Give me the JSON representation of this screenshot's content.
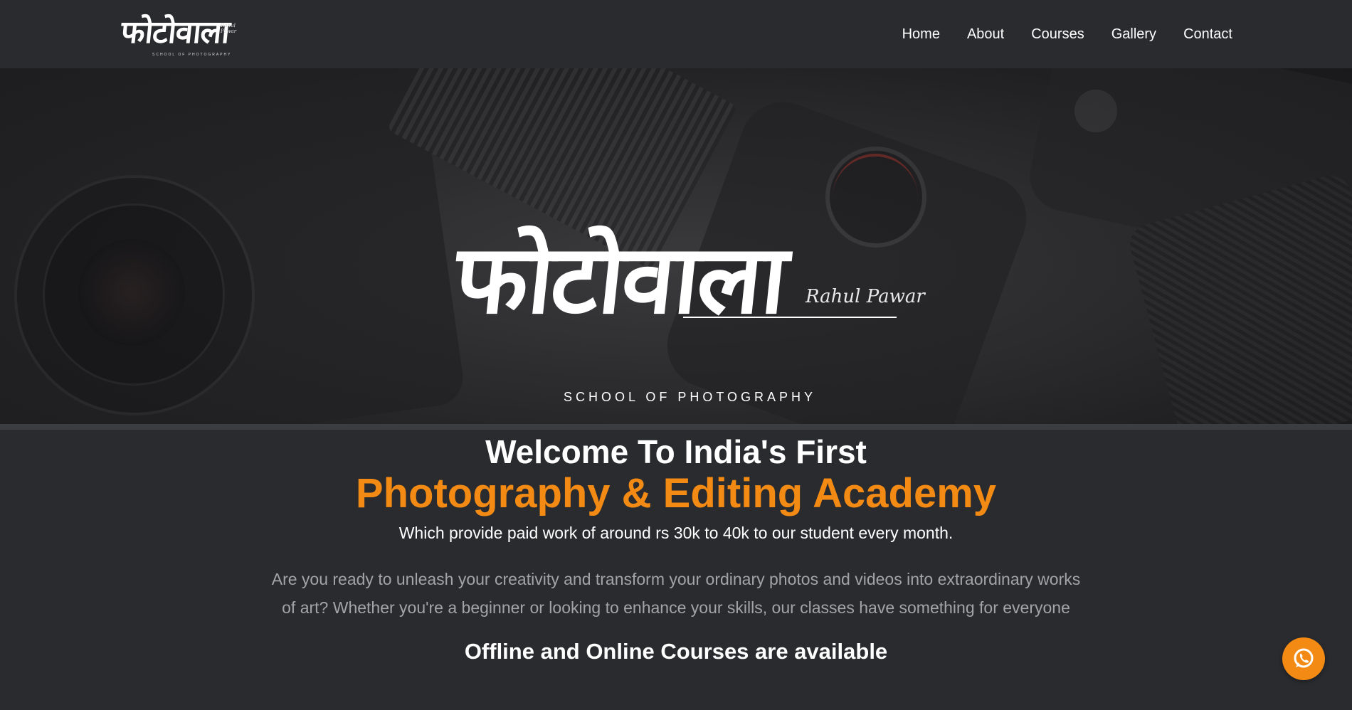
{
  "brand": {
    "logo_text": "फोटोवाला",
    "signature": "Rahul Pawar",
    "tagline": "SCHOOL OF PHOTOGRAPHY"
  },
  "nav": {
    "items": [
      {
        "label": "Home"
      },
      {
        "label": "About"
      },
      {
        "label": "Courses"
      },
      {
        "label": "Gallery"
      },
      {
        "label": "Contact"
      }
    ]
  },
  "hero": {
    "background": "camera-photo"
  },
  "content": {
    "welcome": "Welcome To India's First",
    "academy": "Photography & Editing Academy",
    "subtitle": "Which provide paid work of around rs 30k to 40k to our student every month.",
    "description": "Are you ready to unleash your creativity and transform your ordinary photos and videos into extraordinary works of art? Whether you're a beginner or looking to enhance your skills, our classes have something for everyone",
    "courses_note": "Offline and Online Courses are available"
  },
  "fab": {
    "icon": "whatsapp-icon"
  },
  "colors": {
    "background": "#2a2b2f",
    "accent": "#f28a14",
    "muted_text": "#a4a4a6"
  }
}
